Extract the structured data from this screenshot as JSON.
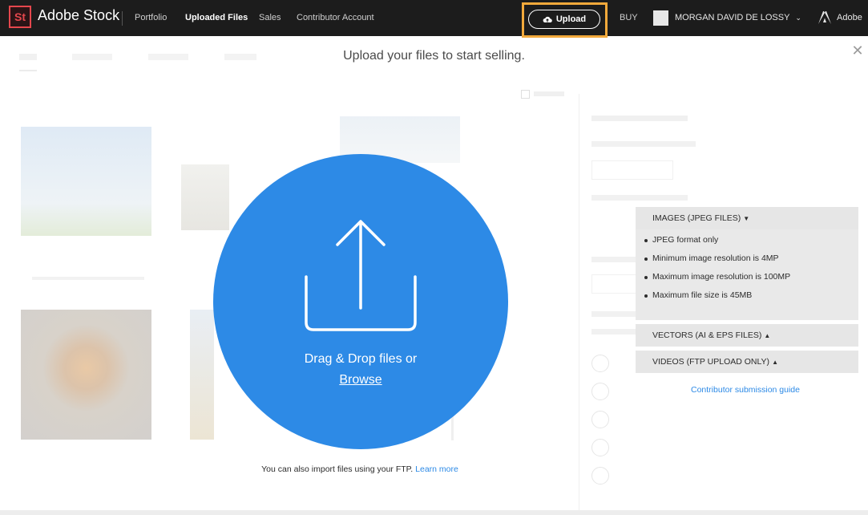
{
  "topbar": {
    "logo_text": "St",
    "brand": "Adobe Stock",
    "nav": [
      "Portfolio",
      "Uploaded Files",
      "Sales",
      "Contributor Account"
    ],
    "active_nav": "Uploaded Files",
    "upload_label": "Upload",
    "buy_label": "BUY",
    "user_name": "MORGAN DAVID DE LOSSY",
    "adobe_label": "Adobe"
  },
  "dialog": {
    "headline": "Upload your files to start selling.",
    "drop_text": "Drag & Drop files or",
    "browse_label": "Browse",
    "ftp_text": "You can also import files using your FTP.",
    "learn_more": "Learn more"
  },
  "requirements": {
    "images_header": "IMAGES (JPEG FILES)",
    "images_items": [
      "JPEG format only",
      "Minimum image resolution is 4MP",
      "Maximum image resolution is 100MP",
      "Maximum file size is 45MB"
    ],
    "vectors_header": "VECTORS (AI & EPS FILES)",
    "videos_header": "VIDEOS (FTP UPLOAD ONLY)",
    "guide_link": "Contributor submission guide"
  },
  "colors": {
    "accent_blue": "#2d8ae6",
    "highlight_orange": "#f2a93b",
    "topbar": "#1c1c1c",
    "logo_red": "#e5474d"
  }
}
